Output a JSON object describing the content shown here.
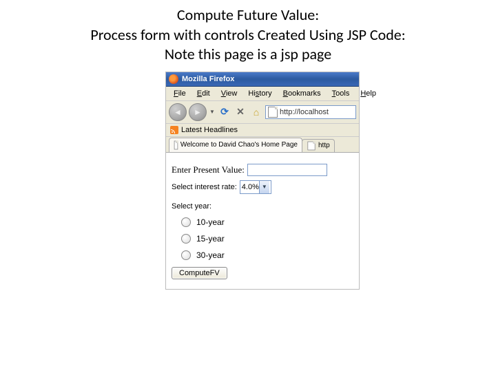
{
  "slide": {
    "title_l1": "Compute Future Value:",
    "title_l2": "Process form with controls Created Using JSP Code:",
    "title_l3": "Note this page is a jsp page"
  },
  "browser": {
    "window_title": "Mozilla Firefox",
    "menu": {
      "file": "File",
      "edit": "Edit",
      "view": "View",
      "history": "History",
      "bookmarks": "Bookmarks",
      "tools": "Tools",
      "help": "Help"
    },
    "url": "http://localhost",
    "bookmarks_bar": {
      "latest": "Latest Headlines"
    },
    "tabs": {
      "active": "Welcome to David Chao's Home Page",
      "inactive": "http"
    }
  },
  "form": {
    "present_value_label": "Enter Present Value:",
    "present_value": "",
    "rate_label": "Select interest rate:",
    "rate_selected": "4.0%",
    "year_label": "Select year:",
    "year_options": [
      "10-year",
      "15-year",
      "30-year"
    ],
    "submit_label": "ComputeFV"
  }
}
